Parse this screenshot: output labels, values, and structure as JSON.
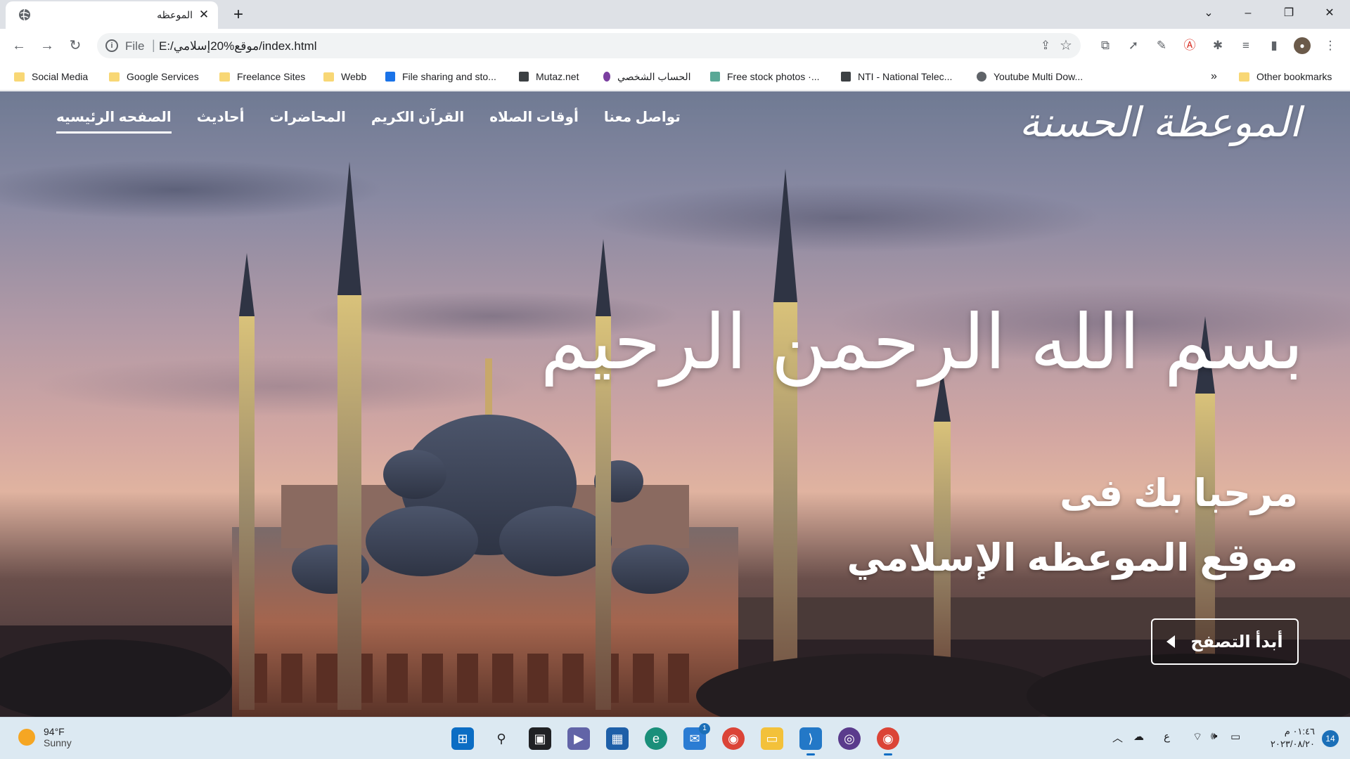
{
  "browser": {
    "tab": {
      "title": "الموعظه",
      "close": "✕",
      "favicon": "globe-icon"
    },
    "new_tab": "+",
    "window_controls": {
      "dropdown": "⌄",
      "minimize": "–",
      "restore": "❐",
      "close": "✕"
    },
    "address": {
      "scheme": "File",
      "separator": "|",
      "url": "E:/موقع%20إسلامي/index.html"
    },
    "bookmarks": [
      {
        "label": "Social Media",
        "icon": "folder-icon"
      },
      {
        "label": "Google Services",
        "icon": "folder-icon"
      },
      {
        "label": "Freelance Sites",
        "icon": "folder-icon"
      },
      {
        "label": "Webb",
        "icon": "folder-icon"
      },
      {
        "label": "File sharing and sto...",
        "icon": "filesharing-icon"
      },
      {
        "label": "Mutaz.net",
        "icon": "mutaz-icon"
      },
      {
        "label": "الحساب الشخصي",
        "icon": "account-icon"
      },
      {
        "label": "Free stock photos ·...",
        "icon": "stock-photos-icon"
      },
      {
        "label": "NTI - National Telec...",
        "icon": "nti-icon"
      },
      {
        "label": "Youtube Multi Dow...",
        "icon": "globe-icon"
      }
    ],
    "bookmarks_overflow": "»",
    "other_bookmarks": "Other bookmarks"
  },
  "site": {
    "logo": "الموعظة الحسنة",
    "nav": [
      {
        "label": "الصفحه الرئيسيه",
        "active": true
      },
      {
        "label": "أحاديث",
        "active": false
      },
      {
        "label": "المحاضرات",
        "active": false
      },
      {
        "label": "القرآن الكريم",
        "active": false
      },
      {
        "label": "أوقات الصلاه",
        "active": false
      },
      {
        "label": "تواصل معنا",
        "active": false
      }
    ],
    "basmala": "بسم الله الرحمن الرحيم",
    "welcome_line1": "مرحبا بك فى",
    "welcome_line2": "موقع الموعظه الإسلامي",
    "cta_label": "أبدأ التصفح"
  },
  "taskbar": {
    "weather": {
      "temp": "94°F",
      "condition": "Sunny"
    },
    "tray_lang": "ع",
    "clock": {
      "time": "٠١:٤٦ م",
      "date": "٢٠٢٣/٠٨/٢٠"
    },
    "notifications": "14",
    "mail_badge": "1"
  }
}
